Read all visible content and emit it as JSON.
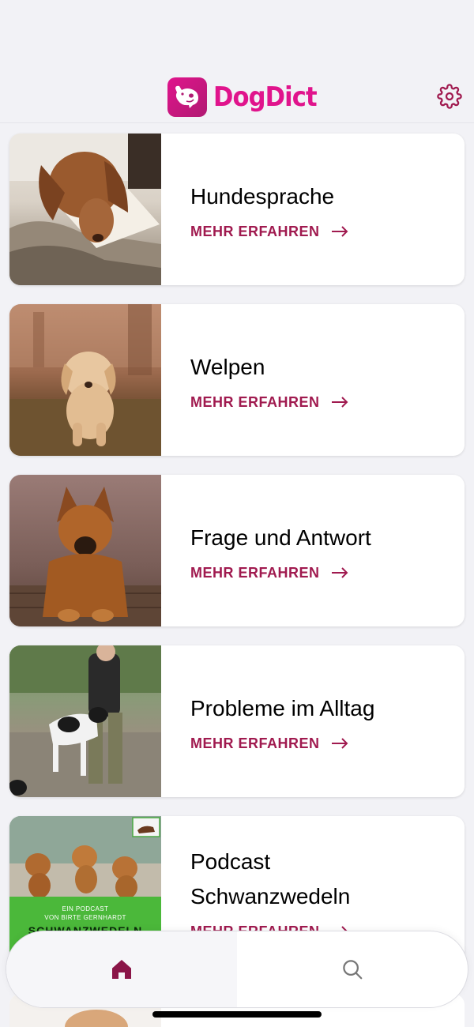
{
  "app": {
    "name": "DogDict",
    "brand_color": "#e0148c",
    "accent_color": "#a01a4f"
  },
  "header": {
    "logo_text": "DogDict",
    "settings_icon": "gear-icon"
  },
  "cards": [
    {
      "title": "Hundesprache",
      "cta": "MEHR ERFAHREN"
    },
    {
      "title": "Welpen",
      "cta": "MEHR ERFAHREN"
    },
    {
      "title": "Frage und Antwort",
      "cta": "MEHR ERFAHREN"
    },
    {
      "title": "Probleme im Alltag",
      "cta": "MEHR ERFAHREN"
    },
    {
      "title": "Podcast Schwanzwedeln",
      "cta": "MEHR ERFAHREN",
      "image_text": {
        "line1": "EIN PODCAST",
        "line2": "VON BIRTE GERNHARDT",
        "line3": "SCHWANZWEDELN"
      }
    }
  ],
  "tabbar": {
    "tabs": [
      {
        "icon": "home-icon",
        "active": true
      },
      {
        "icon": "search-icon",
        "active": false
      }
    ]
  }
}
